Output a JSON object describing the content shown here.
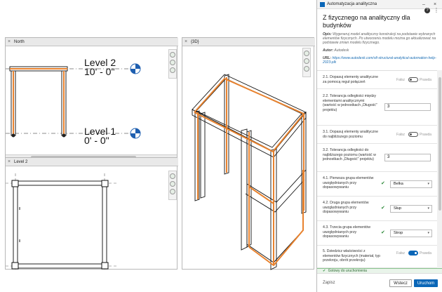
{
  "views": {
    "north_tab": "North",
    "level2_tab": "Level 2",
    "view3d_tab": "{3D}",
    "level2_name": "Level 2",
    "level2_elev": "10' - 0\"",
    "level1_name": "Level 1",
    "level1_elev": "0' - 0\""
  },
  "panel": {
    "window_title": "Automatyzacja analityczna",
    "heading": "Z fizycznego na analityczny dla budynków",
    "desc_label": "Opis:",
    "desc_text": "Wygeneruj model analityczny konstrukcji na podstawie wybranych elementów fizycznych. Po utworzeniu modelu można go aktualizować na podstawie zmian modelu fizycznego.",
    "author_label": "Autor:",
    "author": "Autodesk",
    "url_label": "URL:",
    "url": "https://www.autodesk.com/vlt-structural-analytical-automation-help-2023-plk",
    "rows": [
      {
        "label": "2.1. Dopasuj elementy analityczne za pomocą reguł połączeń",
        "false_label": "Fałsz",
        "true_label": "Prawda",
        "on": false
      },
      {
        "label": "2.2. Tolerancja odległości między elementami analitycznymi (wartość w jednostkach „Długość” projektu)",
        "value": "3"
      },
      {
        "label": "3.1. Dopasuj elementy analityczne do najbliższego poziomu",
        "false_label": "Fałsz",
        "true_label": "Prawda",
        "on": false
      },
      {
        "label": "3.2. Tolerancja odległości do najbliższego poziomu (wartość w jednostkach „Długość” projektu)",
        "value": "3"
      },
      {
        "label": "4.1. Pierwsza grupa elementów uwzględnianych przy dopasowywaniu",
        "select": "Belka"
      },
      {
        "label": "4.2. Druga grupa elementów uwzględnianych przy dopasowywaniu",
        "select": "Słup"
      },
      {
        "label": "4.3. Trzecia grupa elementów uwzględnianych przy dopasowywaniu",
        "select": "Strop"
      },
      {
        "label": "5. Dziedzicz właściwości z elementów fizycznych (materiał, typ przekroju, obrót przekroju)",
        "false_label": "Fałsz",
        "true_label": "Prawda",
        "on": true
      }
    ],
    "status": "Gotowy do uruchomienia",
    "save_label": "Zapisz",
    "reset_label": "Wstecz",
    "run_label": "Uruchom"
  },
  "colors": {
    "accent": "#0a66b7",
    "member_highlight": "#e8822e",
    "ok_green": "#2e8b3a"
  }
}
